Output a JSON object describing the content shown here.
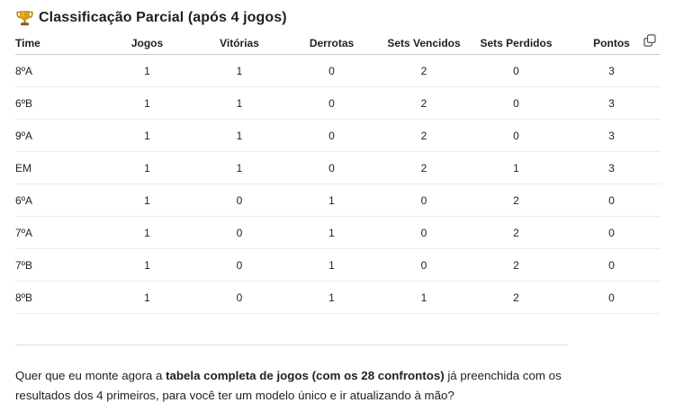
{
  "heading": {
    "icon": "trophy-icon",
    "title": "Classificação Parcial (após 4 jogos)"
  },
  "table": {
    "columns": [
      "Time",
      "Jogos",
      "Vitórias",
      "Derrotas",
      "Sets Vencidos",
      "Sets Perdidos",
      "Pontos"
    ],
    "rows": [
      [
        "8ºA",
        "1",
        "1",
        "0",
        "2",
        "0",
        "3"
      ],
      [
        "6ºB",
        "1",
        "1",
        "0",
        "2",
        "0",
        "3"
      ],
      [
        "9ºA",
        "1",
        "1",
        "0",
        "2",
        "0",
        "3"
      ],
      [
        "EM",
        "1",
        "1",
        "0",
        "2",
        "1",
        "3"
      ],
      [
        "6ºA",
        "1",
        "0",
        "1",
        "0",
        "2",
        "0"
      ],
      [
        "7ºA",
        "1",
        "0",
        "1",
        "0",
        "2",
        "0"
      ],
      [
        "7ºB",
        "1",
        "0",
        "1",
        "0",
        "2",
        "0"
      ],
      [
        "8ºB",
        "1",
        "0",
        "1",
        "1",
        "2",
        "0"
      ]
    ],
    "copy_icon": "copy-icon"
  },
  "message": {
    "part1": "Quer que eu monte agora a ",
    "bold": "tabela completa de jogos (com os 28 confrontos)",
    "part2": " já preenchida com os resultados dos 4 primeiros, para você ter um modelo único e ir atualizando à mão?"
  },
  "colors": {
    "trophy": "#d4a017",
    "text": "#1f1f1f",
    "row_border": "#ececec"
  }
}
